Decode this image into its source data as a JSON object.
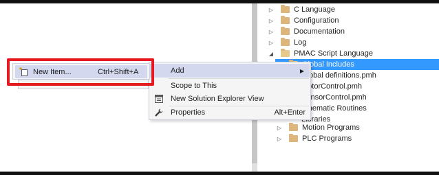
{
  "tree": {
    "items": [
      {
        "label": "C Language",
        "expander": "▷",
        "open": false
      },
      {
        "label": "Configuration",
        "expander": "▷",
        "open": false
      },
      {
        "label": "Documentation",
        "expander": "▷",
        "open": false
      },
      {
        "label": "Log",
        "expander": "▷",
        "open": false
      },
      {
        "label": "PMAC Script Language",
        "expander": "◢",
        "open": true
      },
      {
        "label": "Global Includes",
        "expander": "◢",
        "open": true,
        "selected": true
      },
      {
        "label": "Global definitions.pmh"
      },
      {
        "label": "MotorControl.pmh"
      },
      {
        "label": "SensorControl.pmh"
      },
      {
        "label": "Kinematic Routines"
      },
      {
        "label": "Libraries"
      },
      {
        "label": "Motion Programs",
        "expander": "▷",
        "open": false
      },
      {
        "label": "PLC Programs",
        "expander": "▷",
        "open": false
      }
    ]
  },
  "context_menu": {
    "items": [
      {
        "label": "Add",
        "shortcut": "",
        "icon": "",
        "submenu_arrow": "▶"
      },
      {
        "label": "Scope to This",
        "shortcut": "",
        "icon": ""
      },
      {
        "label": "New Solution Explorer View",
        "shortcut": "",
        "icon": "new-explorer-view-icon"
      },
      {
        "label": "Properties",
        "shortcut": "Alt+Enter",
        "icon": "wrench-icon"
      }
    ]
  },
  "submenu": {
    "items": [
      {
        "label": "New Item...",
        "shortcut": "Ctrl+Shift+A",
        "icon": "new-item-icon"
      }
    ]
  },
  "colors": {
    "selection": "#3399ff",
    "menu_hover": "#d3d8ee",
    "highlight_border": "#e5191f",
    "menu_bg": "#f5f5f5",
    "folder": "#dcb67a"
  }
}
